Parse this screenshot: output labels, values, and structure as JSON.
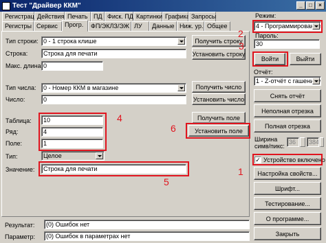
{
  "window": {
    "title": "Тест \"Драйвер ККМ\""
  },
  "tabs_row1": [
    "Регистрация",
    "Действия",
    "Печать",
    "ПД",
    "Фиск. ПД",
    "Картинки",
    "Графика",
    "Запросы"
  ],
  "tabs_row2": [
    "Регистры",
    "Сервис",
    "Прогр.",
    "ФП/ЭКЛЗ/ЭЖ",
    "ЛУ",
    "Данные",
    "Ниж. ур.",
    "Общее"
  ],
  "form": {
    "string_type_label": "Тип строки:",
    "string_type_value": "0 - 1 строка клише",
    "string_label": "Строка:",
    "string_value": "Строка для печати",
    "max_len_label": "Макс. длина:",
    "max_len_value": "0",
    "number_type_label": "Тип числа:",
    "number_type_value": "0 - Номер ККМ в магазине",
    "number_label": "Число:",
    "number_value": "0",
    "table_label": "Таблица:",
    "table_value": "10",
    "row_label": "Ряд:",
    "row_value": "4",
    "field_label": "Поле:",
    "field_value": "1",
    "type_label": "Тип:",
    "type_value": "Целое",
    "value_label": "Значение:",
    "value_value": "Строка для печати"
  },
  "buttons": {
    "get_string": "Получить строку",
    "set_string": "Установить строку",
    "get_number": "Получить число",
    "set_number": "Установить число",
    "get_field": "Получить поле",
    "set_field": "Установить поле"
  },
  "right_panel": {
    "mode_label": "Режим:",
    "mode_value": "4 - Программирование",
    "password_label": "Пароль:",
    "password_value": "30",
    "login": "Войти",
    "logout": "Выйти",
    "report_label": "Отчёт:",
    "report_value": "1 - Z-отчёт с гашением",
    "take_report": "Снять отчёт",
    "partial_cut": "Неполная отрезка",
    "full_cut": "Полная отрезка",
    "width_label_1": "Ширина",
    "width_label_2": "симв/пикс:",
    "width_chars": "36",
    "width_pixels": "384",
    "device_enabled": "Устройство включено",
    "check_mark": "✓",
    "settings": "Настройка свойств...",
    "font": "Шрифт...",
    "testing": "Тестирование...",
    "about": "О программе...",
    "close": "Закрыть"
  },
  "status": {
    "result_label": "Результат:",
    "result_value": "(0) Ошибок нет",
    "params_label": "Параметр:",
    "params_value": "(0) Ошибок в параметрах нет"
  },
  "annotations": [
    "1",
    "2",
    "3",
    "4",
    "5",
    "6"
  ],
  "colors": {
    "annotation": "#e0141e",
    "titlebar": "#0a246a"
  }
}
